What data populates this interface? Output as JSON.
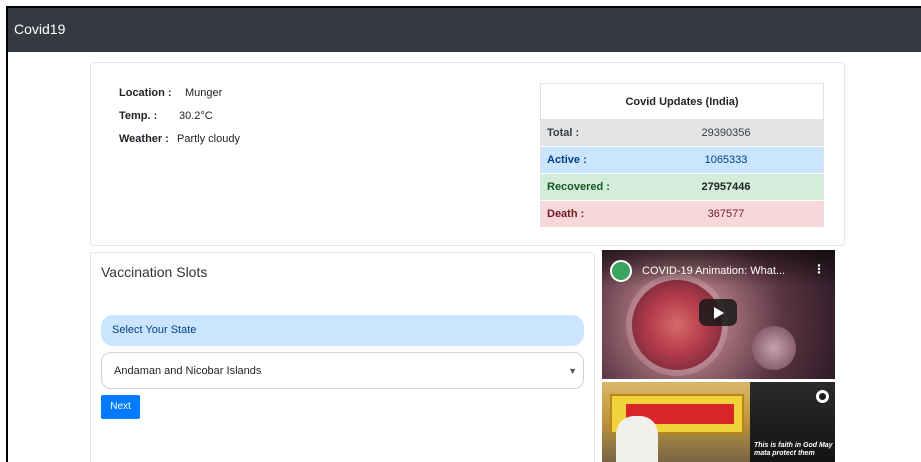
{
  "navbar": {
    "brand": "Covid19"
  },
  "location_info": {
    "location_label": "Location :",
    "location_value": "Munger",
    "temp_label": "Temp. :",
    "temp_value": "30.2°C",
    "weather_label": "Weather :",
    "weather_value": "Partly cloudy"
  },
  "covid_updates": {
    "title": "Covid Updates (India)",
    "rows": [
      {
        "label": "Total :",
        "value": "29390356"
      },
      {
        "label": "Active :",
        "value": "1065333"
      },
      {
        "label": "Recovered :",
        "value": "27957446"
      },
      {
        "label": "Death :",
        "value": "367577"
      }
    ]
  },
  "vaccination": {
    "title": "Vaccination Slots",
    "state_label": "Select Your State",
    "selected_state": "Andaman and Nicobar Islands",
    "next_label": "Next"
  },
  "video": {
    "title": "COVID-19 Animation: What..."
  },
  "reel": {
    "caption": "This is faith in God May mata protect them"
  },
  "colors": {
    "navbar": "#343a40",
    "primary": "#007bff",
    "active_bg": "#cce5ff",
    "recovered_bg": "#d4edda",
    "death_bg": "#f8d7da",
    "total_bg": "#e2e3e5"
  }
}
